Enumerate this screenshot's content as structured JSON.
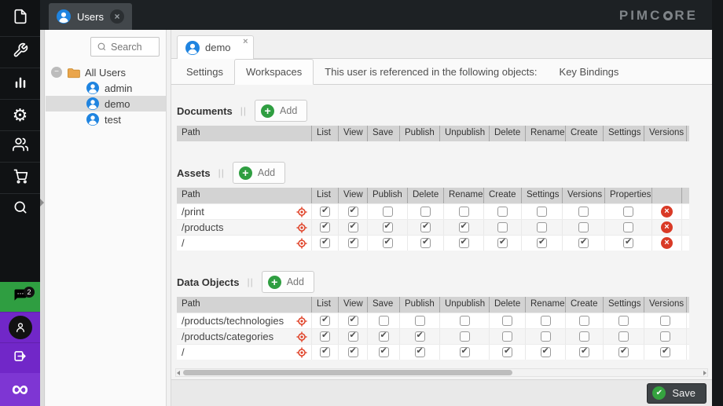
{
  "topbar": {
    "tab_label": "Users",
    "logo_prefix": "PIMC",
    "logo_suffix": "RE"
  },
  "sidebar": {
    "rail_icons": [
      "file-icon",
      "wrench-icon",
      "bar-chart-icon",
      "gear-icon",
      "users-icon",
      "cart-icon",
      "search-icon"
    ],
    "chat_badge": "2",
    "bottom_icons": [
      "chat-icon",
      "user-icon",
      "logout-icon",
      "pimcore-logo-icon"
    ]
  },
  "tree": {
    "search_placeholder": "Search",
    "root_label": "All Users",
    "items": [
      "admin",
      "demo",
      "test"
    ],
    "selected": "demo"
  },
  "panel": {
    "tab_label": "demo",
    "tabs": [
      "Settings",
      "Workspaces",
      "This user is referenced in the following objects:",
      "Key Bindings"
    ],
    "active_tab": "Workspaces"
  },
  "workspaces": {
    "sections": [
      {
        "title": "Documents",
        "add_label": "Add",
        "columns": [
          "Path",
          "List",
          "View",
          "Save",
          "Publish",
          "Unpublish",
          "Delete",
          "Rename",
          "Create",
          "Settings",
          "Versions"
        ],
        "has_delete_column": false,
        "rows": []
      },
      {
        "title": "Assets",
        "add_label": "Add",
        "columns": [
          "Path",
          "List",
          "View",
          "Publish",
          "Delete",
          "Rename",
          "Create",
          "Settings",
          "Versions",
          "Properties"
        ],
        "has_delete_column": true,
        "rows": [
          {
            "path": "/print",
            "checks": [
              true,
              true,
              false,
              false,
              false,
              false,
              false,
              false,
              false
            ]
          },
          {
            "path": "/products",
            "checks": [
              true,
              true,
              true,
              true,
              true,
              false,
              false,
              false,
              false
            ]
          },
          {
            "path": "/",
            "checks": [
              true,
              true,
              true,
              true,
              true,
              true,
              true,
              true,
              true
            ]
          }
        ]
      },
      {
        "title": "Data Objects",
        "add_label": "Add",
        "columns": [
          "Path",
          "List",
          "View",
          "Save",
          "Publish",
          "Unpublish",
          "Delete",
          "Rename",
          "Create",
          "Settings",
          "Versions"
        ],
        "has_delete_column": false,
        "rows": [
          {
            "path": "/products/technologies",
            "checks": [
              true,
              true,
              false,
              false,
              false,
              false,
              false,
              false,
              false,
              false
            ]
          },
          {
            "path": "/products/categories",
            "checks": [
              true,
              true,
              true,
              true,
              false,
              false,
              false,
              false,
              false,
              false
            ]
          },
          {
            "path": "/",
            "checks": [
              true,
              true,
              true,
              true,
              true,
              true,
              true,
              true,
              true,
              true
            ]
          }
        ]
      }
    ]
  },
  "footer": {
    "save_label": "Save"
  },
  "colors": {
    "accent_blue": "#1f84e0",
    "green": "#2f9e41",
    "purple": "#7127c8",
    "purple_light": "#7e36d3",
    "red": "#d93a26",
    "dark_bar": "#1d2124"
  }
}
